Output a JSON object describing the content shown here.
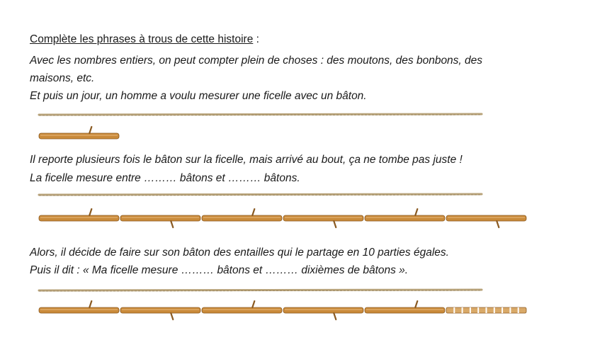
{
  "heading": {
    "title": "Complète les phrases à trous de cette histoire",
    "colon": " :"
  },
  "story": {
    "p1_line1": "Avec les nombres entiers, on peut compter plein de choses :  des moutons, des bonbons, des",
    "p1_line2": "maisons, etc.",
    "p2": "Et puis un jour, un homme a voulu mesurer une ficelle avec un bâton.",
    "p3_line1": "Il reporte plusieurs fois le bâton sur la ficelle, mais arrivé au bout, ça ne tombe pas juste !",
    "p3_line2": "La ficelle mesure entre ……… bâtons et ……… bâtons.",
    "p4_line1": "Alors, il décide de faire sur son bâton des entailles qui le partage en 10 parties égales.",
    "p4_line2": "Puis il dit : « Ma ficelle mesure ……… bâtons et ……… dixièmes de bâtons »."
  },
  "illustrations": {
    "string_color": "#b8a37a",
    "stick_color": "#c98a3a",
    "stick_dark": "#8a5a22",
    "fig1_sticks": 1,
    "fig2_sticks": 6,
    "fig3_sticks": 5,
    "fig3_graduated_divisions": 10
  }
}
